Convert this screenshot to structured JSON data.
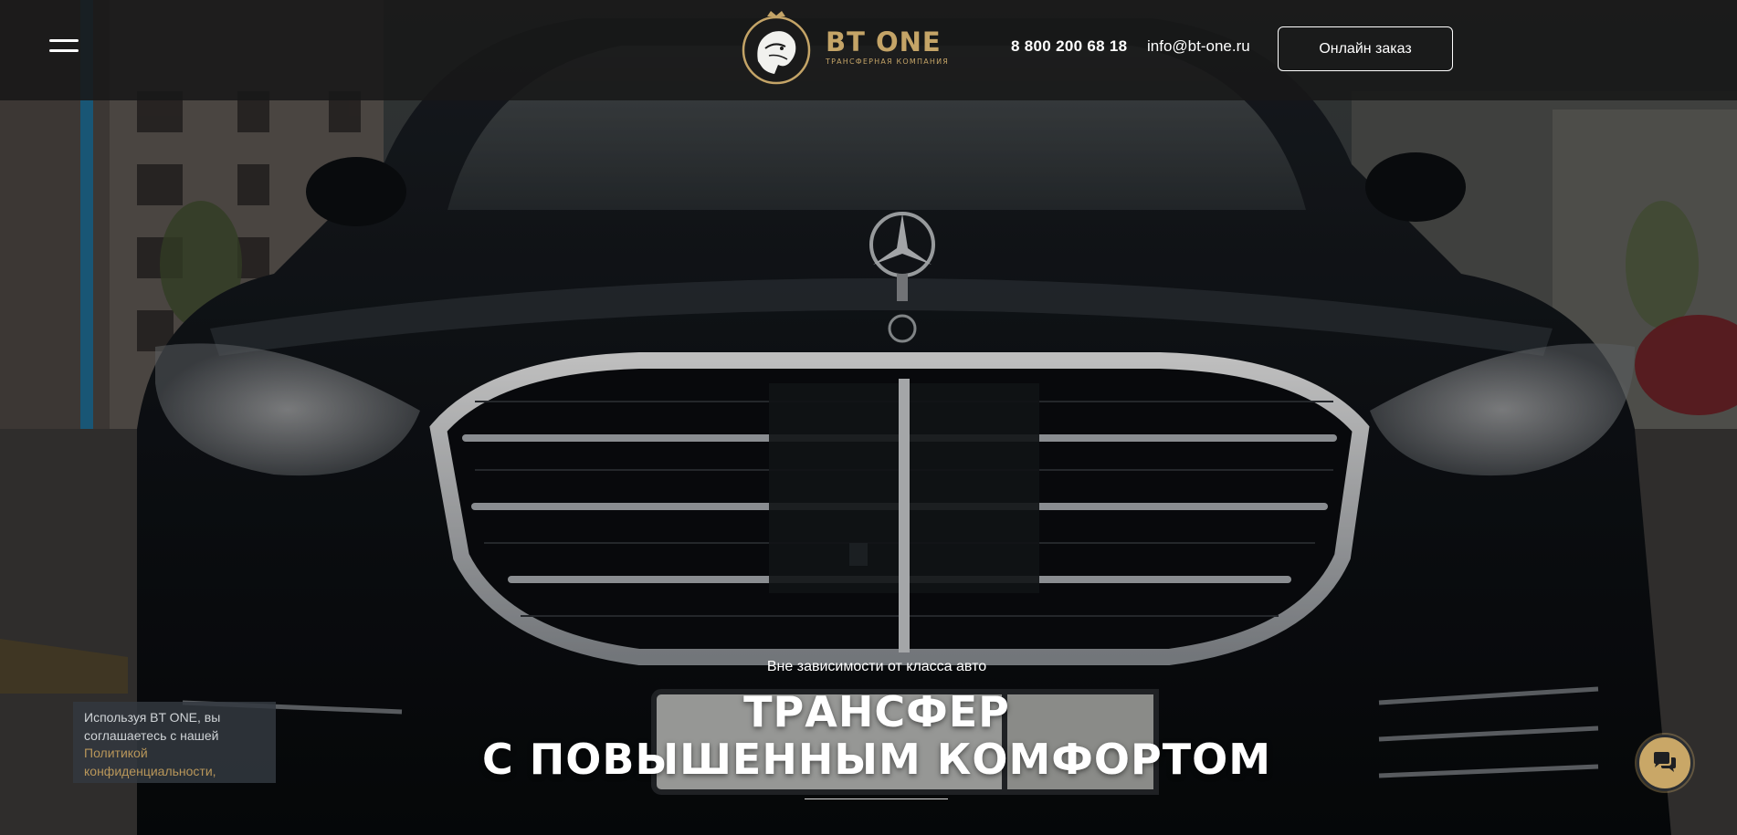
{
  "header": {
    "logo": {
      "name": "BT ONE",
      "tagline": "ТРАНСФЕРНАЯ КОМПАНИЯ"
    },
    "phone": "8 800 200 68 18",
    "email": "info@bt-one.ru",
    "order_button": "Онлайн заказ"
  },
  "hero": {
    "subtitle": "Вне зависимости от класса авто",
    "title_line1": "ТРАНСФЕР",
    "title_line2": "С ПОВЫШЕННЫМ КОМФОРТОМ"
  },
  "cookie_notice": {
    "text": "Используя BT ONE, вы соглашаетесь с нашей",
    "link": "Политикой конфиденциальности,"
  },
  "icons": {
    "menu": "hamburger-menu-icon",
    "logo": "lion-head-logo-icon",
    "chat": "chat-bubbles-icon"
  },
  "colors": {
    "accent_gold": "#c4a467",
    "header_bg": "#181818",
    "chat_button": "#c9a767"
  }
}
